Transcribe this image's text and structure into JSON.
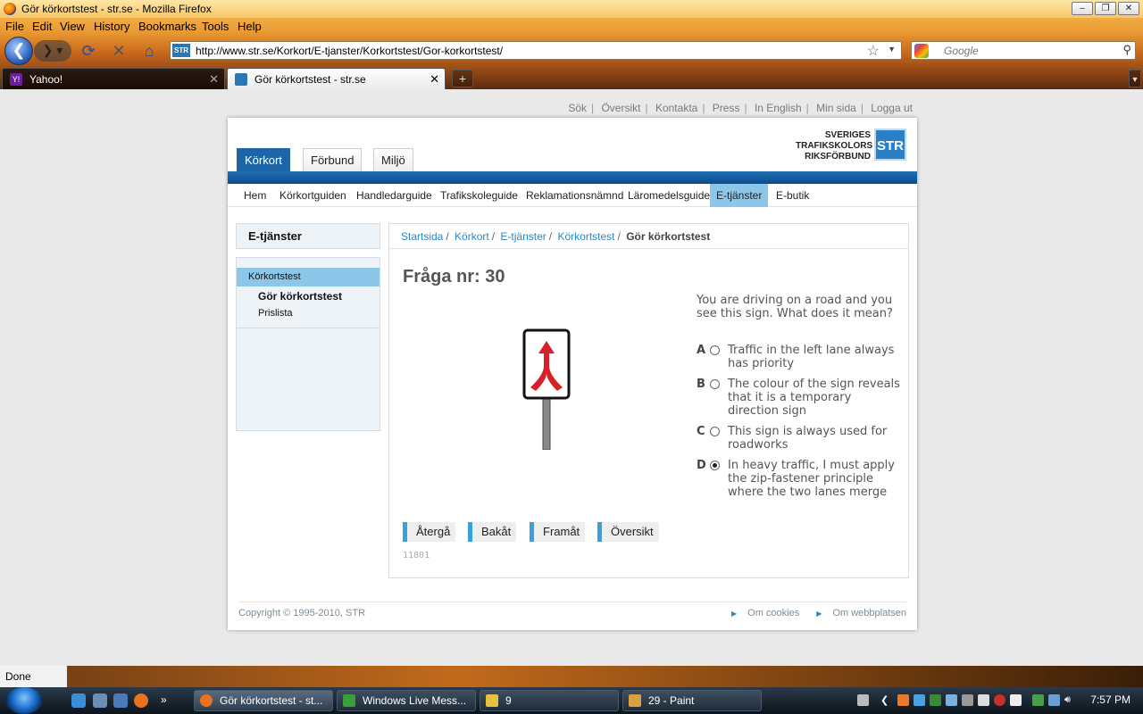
{
  "window": {
    "title": "Gör körkortstest - str.se - Mozilla Firefox"
  },
  "menu": [
    "File",
    "Edit",
    "View",
    "History",
    "Bookmarks",
    "Tools",
    "Help"
  ],
  "address": {
    "url": "http://www.str.se/Korkort/E-tjanster/Korkortstest/Gor-korkortstest/",
    "search_placeholder": "Google"
  },
  "tabs": [
    {
      "label": "Yahoo!"
    },
    {
      "label": "Gör körkortstest - str.se"
    }
  ],
  "site": {
    "toplinks": [
      "Sök",
      "Översikt",
      "Kontakta",
      "Press",
      "In English",
      "Min sida",
      "Logga ut"
    ],
    "brand": {
      "line1": "SVERIGES",
      "line2": "TRAFIKSKOLORS",
      "line3": "RIKSFÖRBUND",
      "mark": "STR"
    },
    "main_tabs": [
      "Körkort",
      "Förbund",
      "Miljö"
    ],
    "subnav": [
      "Hem",
      "Körkortguiden",
      "Handledarguide",
      "Trafikskoleguide",
      "Reklamationsnämnd",
      "Läromedelsguide",
      "E-tjänster",
      "E-butik"
    ],
    "sidebar": {
      "heading": "E-tjänster",
      "section": "Körkortstest",
      "items": [
        "Gör körkortstest",
        "Prislista"
      ]
    },
    "breadcrumb": [
      "Startsida",
      "Körkort",
      "E-tjänster",
      "Körkortstest",
      "Gör körkortstest"
    ],
    "quiz": {
      "title": "Fråga nr: 30",
      "question": "You are driving on a road and you see this sign. What does it mean?",
      "answers": [
        {
          "letter": "A",
          "text": "Traffic in the left lane always has priority",
          "selected": false
        },
        {
          "letter": "B",
          "text": "The colour of the sign reveals that it is a temporary direction sign",
          "selected": false
        },
        {
          "letter": "C",
          "text": "This sign is always used for roadworks",
          "selected": false
        },
        {
          "letter": "D",
          "text": "In heavy traffic, I must apply the zip-fastener principle where the two lanes merge",
          "selected": true
        }
      ],
      "buttons": [
        "Återgå",
        "Bakåt",
        "Framåt",
        "Översikt"
      ],
      "code": "11801"
    },
    "footer": {
      "copyright": "Copyright © 1995-2010, STR",
      "links": [
        "Om cookies",
        "Om webbplatsen"
      ]
    }
  },
  "status": "Done",
  "taskbar": {
    "items": [
      "Gör körkortstest - st...",
      "Windows Live Mess...",
      "9",
      "29 - Paint"
    ],
    "clock": "7:57 PM"
  },
  "colors": {
    "accent": "#1c66a8",
    "highlight": "#8cc7ea",
    "link": "#2a87c7"
  }
}
